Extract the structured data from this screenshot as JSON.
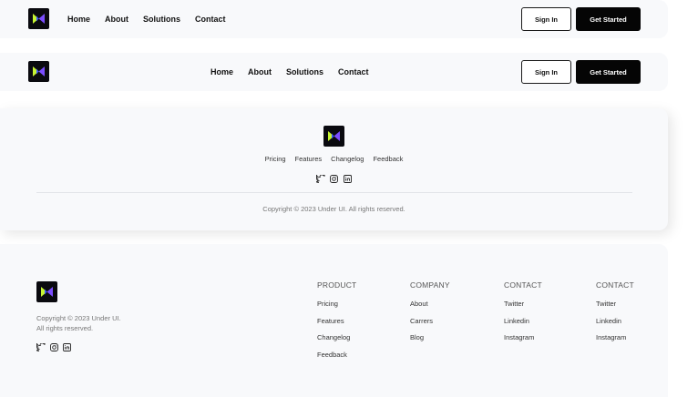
{
  "nav": {
    "links": [
      "Home",
      "About",
      "Solutions",
      "Contact"
    ],
    "sign_in": "Sign In",
    "get_started": "Get Started"
  },
  "footer_simple": {
    "links": [
      "Pricing",
      "Features",
      "Changelog",
      "Feedback"
    ],
    "copyright": "Copyright © 2023 Under UI. All rights reserved."
  },
  "footer_columns": {
    "copyright_line1": "Copyright © 2023 Under UI.",
    "copyright_line2": "All rights reserved.",
    "columns": [
      {
        "heading": "PRODUCT",
        "items": [
          "Pricing",
          "Features",
          "Changelog",
          "Feedback"
        ]
      },
      {
        "heading": "COMPANY",
        "items": [
          "About",
          "Carrers",
          "Blog"
        ]
      },
      {
        "heading": "CONTACT",
        "items": [
          "Twitter",
          "Linkedin",
          "Instagram"
        ]
      },
      {
        "heading": "CONTACT",
        "items": [
          "Twitter",
          "Linkedin",
          "Instagram"
        ]
      }
    ]
  },
  "icons": [
    "logo-icon",
    "twitter-icon",
    "instagram-icon",
    "linkedin-icon"
  ],
  "colors": {
    "card_bg": "#f8f9fb",
    "primary_button": "#050505",
    "logo_bg": "#0a0a0f",
    "logo_green": "#c6f432",
    "logo_purple": "#7b4dff"
  }
}
